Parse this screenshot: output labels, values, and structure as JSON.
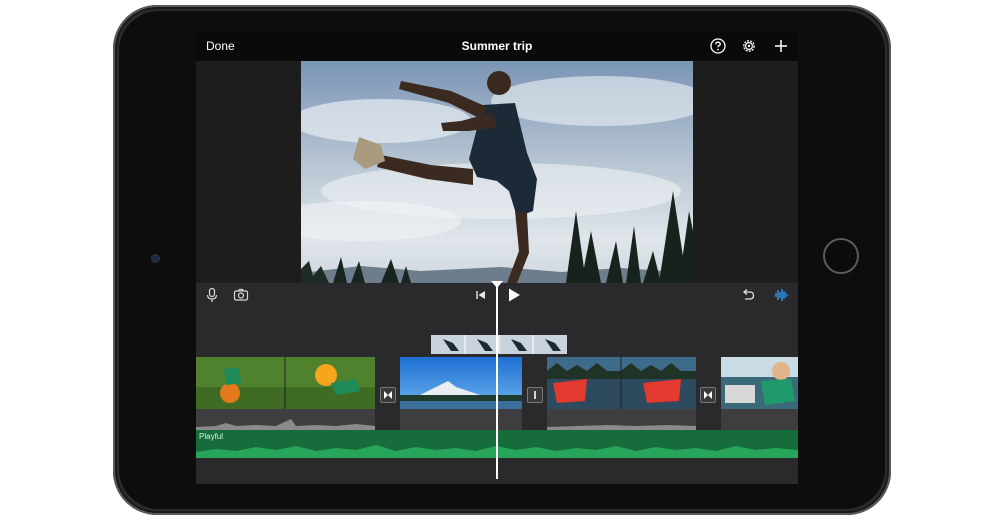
{
  "topbar": {
    "done_label": "Done",
    "title": "Summer trip",
    "icons": [
      "help-icon",
      "settings-gear-icon",
      "add-plus-icon"
    ]
  },
  "toolbar": {
    "icons": [
      "microphone-icon",
      "camera-icon",
      "skip-to-start-icon",
      "play-icon",
      "undo-icon",
      "audio-waveform-icon"
    ],
    "accent_color": "#2f9cff"
  },
  "audio_track": {
    "label": "Playful",
    "color": "#166c3a"
  },
  "device_color": "#2b2b2d"
}
